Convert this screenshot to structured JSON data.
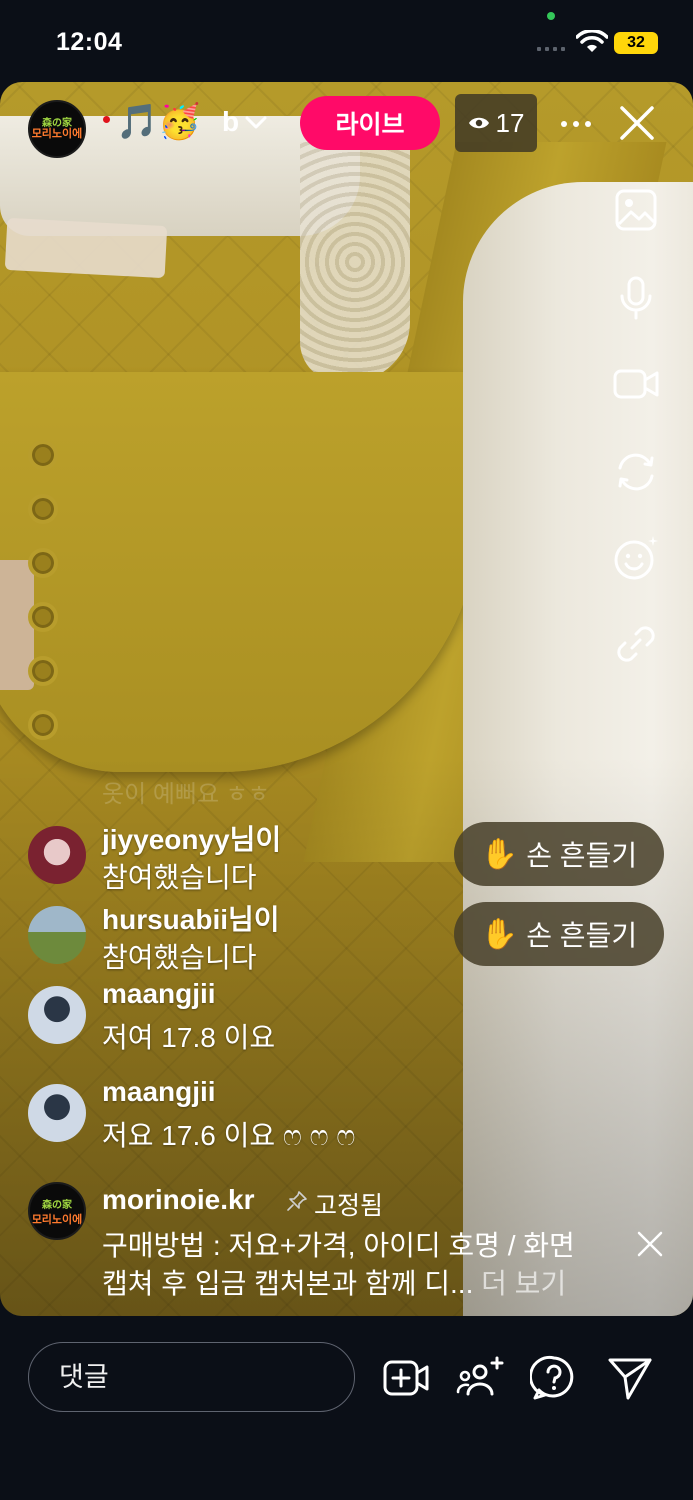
{
  "status_bar": {
    "time": "12:04",
    "battery": "32"
  },
  "live": {
    "host_name": "b",
    "live_label": "라이브",
    "viewer_count": "17",
    "host_logo_top": "森の家",
    "host_logo_bottom": "모리노이에"
  },
  "overlay_text": "옷이 예뻐요 ㅎㅎ",
  "comments": [
    {
      "name": "jiyyeonyy님이",
      "text": "참여했습니다"
    },
    {
      "name": "hursuabii님이",
      "text": "참여했습니다"
    },
    {
      "name": "maangjii",
      "text": "저여 17.8 이요"
    },
    {
      "name": "maangjii",
      "text": "저요 17.6 이요 ෆ ෆ ෆ"
    }
  ],
  "wave_button_label": "손 흔들기",
  "pinned": {
    "name": "morinoie.kr",
    "status": "고정됨",
    "line1": "구매방법 : 저요+가격, 아이디 호명 / 화면",
    "line2": "캡쳐 후 입금 캡처본과 함께 디...",
    "more": "더 보기"
  },
  "bottom_bar": {
    "comment_placeholder": "댓글"
  },
  "icons": {
    "right_rail": [
      "image-icon",
      "microphone-icon",
      "video-camera-icon",
      "flip-camera-icon",
      "effects-face-icon",
      "link-icon"
    ],
    "bottom": [
      "add-video-icon",
      "add-guest-icon",
      "question-icon",
      "send-icon"
    ]
  },
  "colors": {
    "live_badge": "#ff0a68",
    "background": "#0b0f17"
  }
}
